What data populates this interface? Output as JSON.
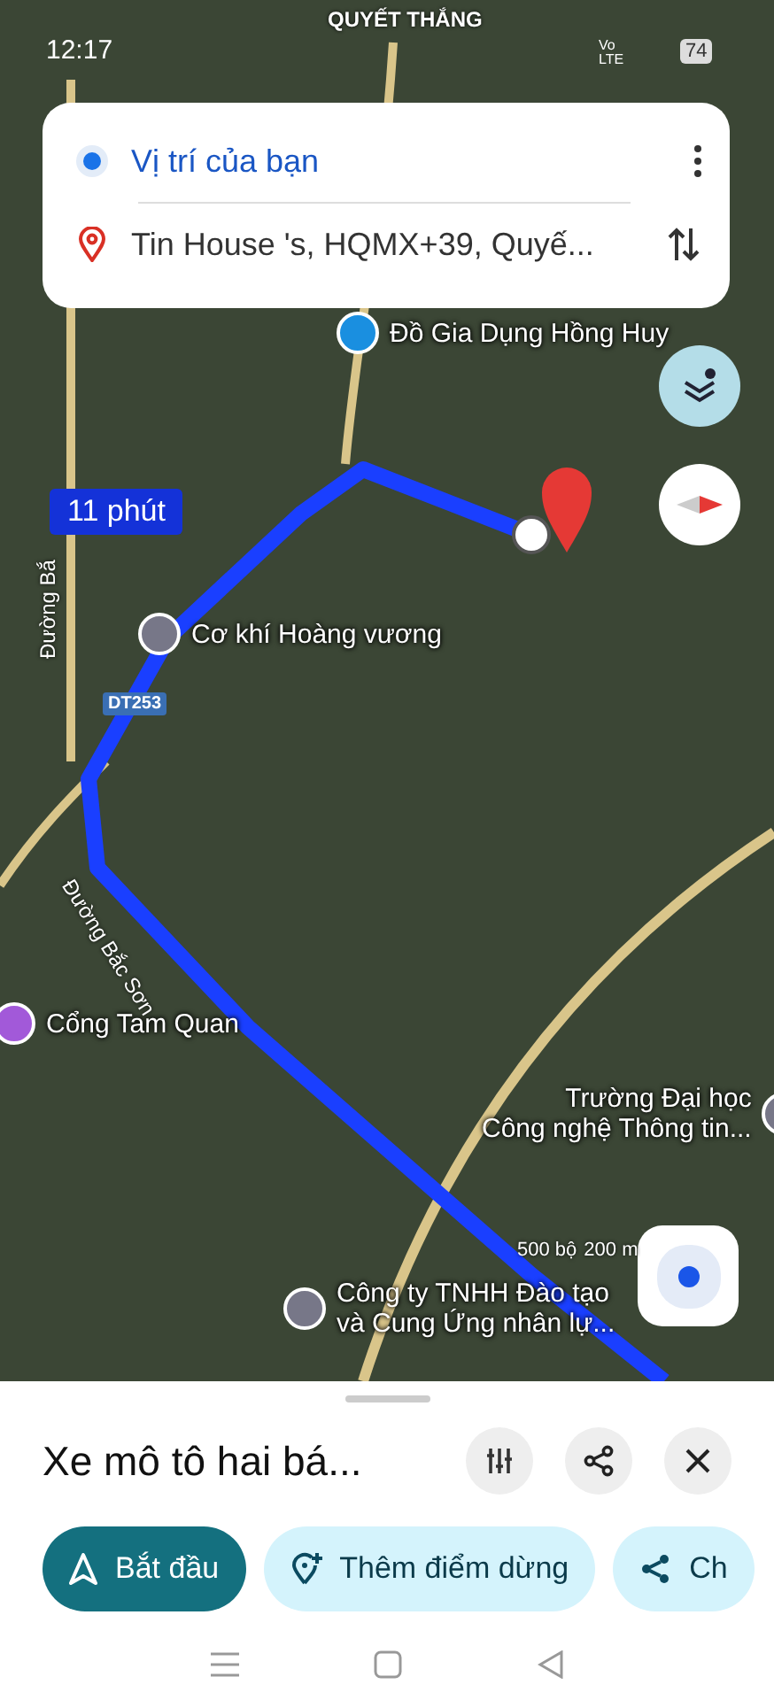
{
  "status_bar": {
    "time": "12:17",
    "area_label": "QUYẾT THẮNG",
    "network": "Vo LTE",
    "battery": "74"
  },
  "directions": {
    "origin": "Vị trí của bạn",
    "destination": "Tin House 's, HQMX+39, Quyế..."
  },
  "map": {
    "route_time": "11 phút",
    "road_badge": "DT253",
    "streets": [
      "Đường Bắ",
      "Đường Bắc Sơn"
    ],
    "places": [
      {
        "kind": "shop",
        "lines": [
          "Đồ Gia Dụng Hồng Huy"
        ]
      },
      {
        "kind": "pin",
        "lines": [
          "Cơ khí Hoàng vương"
        ]
      },
      {
        "kind": "camera",
        "lines": [
          "Cổng Tam Quan"
        ]
      },
      {
        "kind": "school",
        "lines": [
          "Trường Đại học",
          "Công nghệ Thông tin..."
        ]
      },
      {
        "kind": "pin",
        "lines": [
          "Công ty TNHH Đào tạo",
          "và Cung Ứng nhân lự..."
        ]
      }
    ],
    "scale": [
      "500 bộ",
      "200 m"
    ]
  },
  "sheet": {
    "title": "Xe mô tô hai bá...",
    "actions": [
      {
        "kind": "primary",
        "label": "Bắt đầu"
      },
      {
        "kind": "stop",
        "label": "Thêm điểm dừng"
      },
      {
        "kind": "share",
        "label": "Ch"
      }
    ]
  }
}
